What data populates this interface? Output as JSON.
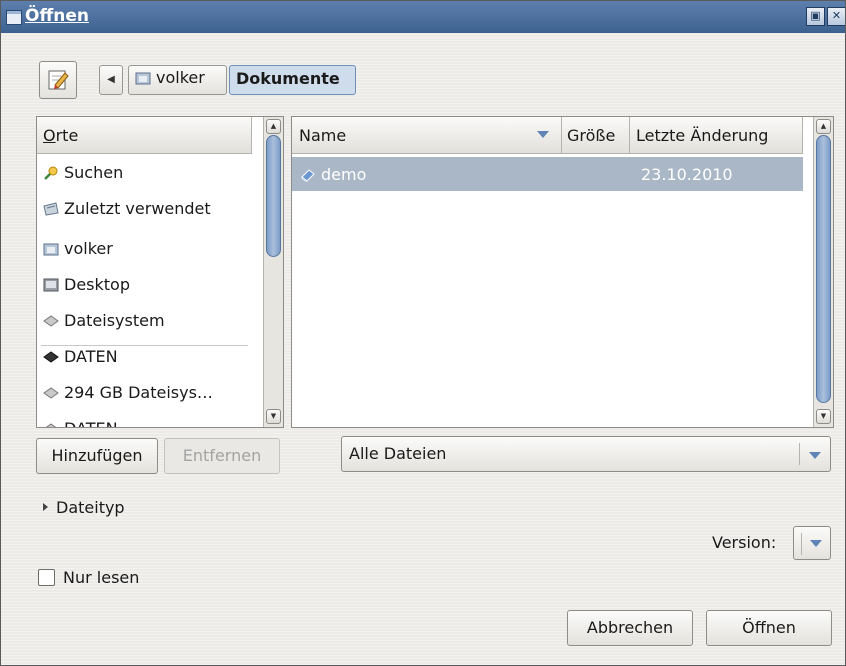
{
  "window": {
    "title": "Öffnen",
    "min_icon": "restore-icon",
    "close_icon": "close-icon"
  },
  "breadcrumb": {
    "back_icon": "chevron-left-icon",
    "items": [
      {
        "label": "volker",
        "icon": "home-folder-icon"
      },
      {
        "label": "Dokumente"
      }
    ]
  },
  "places": {
    "header": "Orte",
    "items": [
      {
        "label": "Suchen",
        "icon": "search-icon"
      },
      {
        "label": "Zuletzt verwendet",
        "icon": "recent-icon"
      },
      {
        "label": "volker",
        "icon": "home-folder-icon"
      },
      {
        "label": "Desktop",
        "icon": "desktop-icon"
      },
      {
        "label": "Dateisystem",
        "icon": "drive-icon"
      },
      {
        "label": "DATEN",
        "icon": "drive-icon"
      },
      {
        "label": "294 GB Dateisys…",
        "icon": "drive-icon"
      },
      {
        "label": "DATEN",
        "icon": "drive-icon"
      }
    ],
    "add_button": "Hinzufügen",
    "remove_button": "Entfernen"
  },
  "files": {
    "columns": {
      "name": "Name",
      "size": "Größe",
      "modified": "Letzte Änderung"
    },
    "rows": [
      {
        "name": "demo",
        "size": "",
        "modified": "23.10.2010",
        "icon": "file-icon"
      }
    ]
  },
  "filter": {
    "selected": "Alle Dateien"
  },
  "expander": {
    "label": "Dateityp"
  },
  "version": {
    "label": "Version:"
  },
  "readonly": {
    "label": "Nur lesen",
    "checked": false
  },
  "buttons": {
    "cancel": "Abbrechen",
    "open": "Öffnen"
  }
}
